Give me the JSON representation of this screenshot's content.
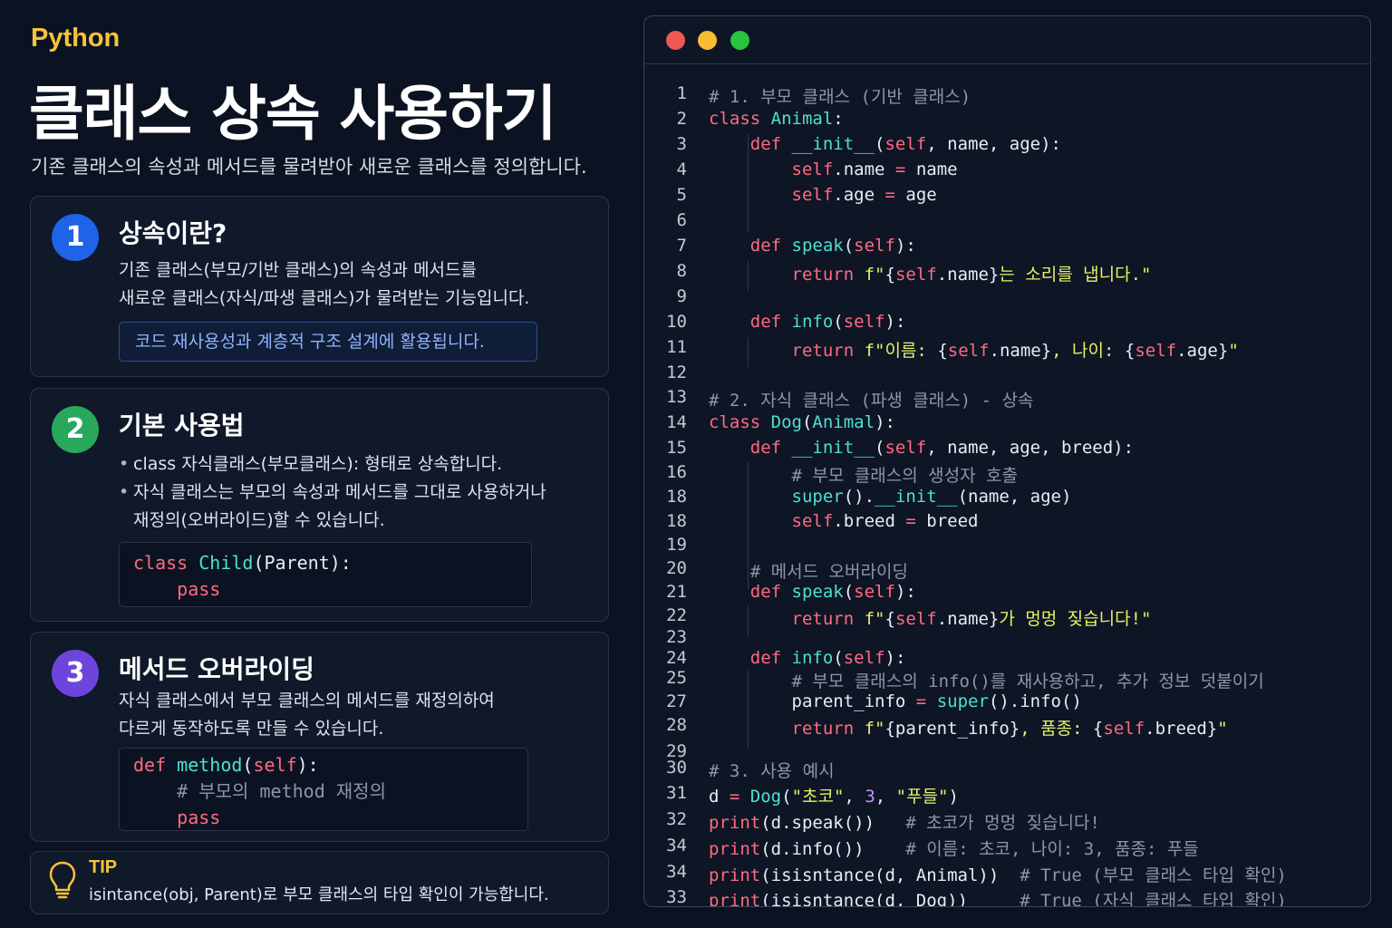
{
  "header": {
    "eyebrow": "Python",
    "title": "클래스 상속 사용하기",
    "subtitle": "기존 클래스의 속성과 메서드를 물려받아 새로운 클래스를 정의합니다."
  },
  "cards": [
    {
      "number": "1",
      "title": "상속이란?",
      "lines": [
        "기존 클래스(부모/기반 클래스)의 속성과 메서드를",
        "새로운 클래스(자식/파생 클래스)가 물려받는 기능입니다."
      ],
      "note": "코드 재사용성과 계층적 구조 설계에 활용됩니다."
    },
    {
      "number": "2",
      "title": "기본 사용법",
      "bullets": [
        {
          "bullet": "•",
          "lines": [
            "class 자식클래스(부모클래스): 형태로 상속합니다."
          ]
        },
        {
          "bullet": "•",
          "lines": [
            "자식 클래스는 부모의 속성과 메서드를 그대로 사용하거나",
            "재정의(오버라이드)할 수 있습니다."
          ]
        }
      ],
      "code": [
        [
          {
            "t": "class ",
            "c": "k"
          },
          {
            "t": "Child",
            "c": "f"
          },
          {
            "t": "(Parent):",
            "c": "t"
          }
        ],
        [
          {
            "t": "    pass",
            "c": "k"
          }
        ]
      ]
    },
    {
      "number": "3",
      "title": "메서드 오버라이딩",
      "lines": [
        "자식 클래스에서 부모 클래스의 메서드를 재정의하여",
        "다르게 동작하도록 만들 수 있습니다."
      ],
      "code": [
        [
          {
            "t": "def ",
            "c": "k"
          },
          {
            "t": "method",
            "c": "f"
          },
          {
            "t": "(",
            "c": "t"
          },
          {
            "t": "self",
            "c": "k"
          },
          {
            "t": "):",
            "c": "t"
          }
        ],
        [
          {
            "t": "    # 부모의 method 재정의",
            "c": "c"
          }
        ],
        [
          {
            "t": "    pass",
            "c": "k"
          }
        ]
      ]
    }
  ],
  "tip": {
    "label": "TIP",
    "text": "isintance(obj, Parent)로 부모 클래스의 타입 확인이 가능합니다."
  },
  "editor": {
    "window_buttons": [
      "close",
      "minimize",
      "maximize"
    ],
    "colors": {
      "close": "#ee5a52",
      "minimize": "#f5bd2f",
      "maximize": "#27c53f"
    },
    "lines": [
      {
        "n": "1",
        "tokens": [
          {
            "t": "# 1. 부모 클래스 (기반 클래스)",
            "c": "c"
          }
        ]
      },
      {
        "n": "2",
        "tokens": [
          {
            "t": "class ",
            "c": "k"
          },
          {
            "t": "Animal",
            "c": "f"
          },
          {
            "t": ":",
            "c": "t"
          }
        ]
      },
      {
        "n": "3",
        "tokens": [
          {
            "t": "    def ",
            "c": "k"
          },
          {
            "t": "__init__",
            "c": "f"
          },
          {
            "t": "(",
            "c": "t"
          },
          {
            "t": "self",
            "c": "k"
          },
          {
            "t": ", name, age):",
            "c": "t"
          }
        ]
      },
      {
        "n": "4",
        "tokens": [
          {
            "t": "        self",
            "c": "k"
          },
          {
            "t": ".name ",
            "c": "t"
          },
          {
            "t": "=",
            "c": "o"
          },
          {
            "t": " name",
            "c": "t"
          }
        ]
      },
      {
        "n": "5",
        "tokens": [
          {
            "t": "        self",
            "c": "k"
          },
          {
            "t": ".age ",
            "c": "t"
          },
          {
            "t": "=",
            "c": "o"
          },
          {
            "t": " age",
            "c": "t"
          }
        ]
      },
      {
        "n": "6",
        "tokens": []
      },
      {
        "n": "7",
        "tokens": [
          {
            "t": "    def ",
            "c": "k"
          },
          {
            "t": "speak",
            "c": "f"
          },
          {
            "t": "(",
            "c": "t"
          },
          {
            "t": "self",
            "c": "k"
          },
          {
            "t": "):",
            "c": "t"
          }
        ]
      },
      {
        "n": "8",
        "tokens": [
          {
            "t": "        return ",
            "c": "k"
          },
          {
            "t": "f\"",
            "c": "s"
          },
          {
            "t": "{",
            "c": "t"
          },
          {
            "t": "self",
            "c": "k"
          },
          {
            "t": ".name}",
            "c": "t"
          },
          {
            "t": "는 소리를 냅니다.\"",
            "c": "s"
          }
        ]
      },
      {
        "n": "9",
        "tokens": []
      },
      {
        "n": "10",
        "tokens": [
          {
            "t": "    def ",
            "c": "k"
          },
          {
            "t": "info",
            "c": "f"
          },
          {
            "t": "(",
            "c": "t"
          },
          {
            "t": "self",
            "c": "k"
          },
          {
            "t": "):",
            "c": "t"
          }
        ]
      },
      {
        "n": "11",
        "tokens": [
          {
            "t": "        return ",
            "c": "k"
          },
          {
            "t": "f\"이름: ",
            "c": "s"
          },
          {
            "t": "{",
            "c": "t"
          },
          {
            "t": "self",
            "c": "k"
          },
          {
            "t": ".name}",
            "c": "t"
          },
          {
            "t": ", 나이: ",
            "c": "s"
          },
          {
            "t": "{",
            "c": "t"
          },
          {
            "t": "self",
            "c": "k"
          },
          {
            "t": ".age}",
            "c": "t"
          },
          {
            "t": "\"",
            "c": "s"
          }
        ]
      },
      {
        "n": "12",
        "tokens": []
      },
      {
        "n": "13",
        "tokens": [
          {
            "t": "# 2. 자식 클래스 (파생 클래스) - 상속",
            "c": "c"
          }
        ]
      },
      {
        "n": "14",
        "tokens": [
          {
            "t": "class ",
            "c": "k"
          },
          {
            "t": "Dog",
            "c": "f"
          },
          {
            "t": "(",
            "c": "t"
          },
          {
            "t": "Animal",
            "c": "f"
          },
          {
            "t": "):",
            "c": "t"
          }
        ]
      },
      {
        "n": "15",
        "tokens": [
          {
            "t": "    def ",
            "c": "k"
          },
          {
            "t": "__init__",
            "c": "f"
          },
          {
            "t": "(",
            "c": "t"
          },
          {
            "t": "self",
            "c": "k"
          },
          {
            "t": ", name, age, breed):",
            "c": "t"
          }
        ]
      },
      {
        "n": "16",
        "tokens": [
          {
            "t": "        # 부모 클래스의 생성자 호출",
            "c": "c"
          }
        ]
      },
      {
        "n": "18",
        "tokens": [
          {
            "t": "        super",
            "c": "f"
          },
          {
            "t": "().",
            "c": "t"
          },
          {
            "t": "__init__",
            "c": "f"
          },
          {
            "t": "(name, age)",
            "c": "t"
          }
        ]
      },
      {
        "n": "18",
        "tokens": [
          {
            "t": "        self",
            "c": "k"
          },
          {
            "t": ".breed ",
            "c": "t"
          },
          {
            "t": "=",
            "c": "o"
          },
          {
            "t": " breed",
            "c": "t"
          }
        ]
      },
      {
        "n": "19",
        "tokens": []
      },
      {
        "n": "20",
        "tokens": [
          {
            "t": "    # 메서드 오버라이딩",
            "c": "c"
          }
        ]
      },
      {
        "n": "21",
        "tokens": [
          {
            "t": "    def ",
            "c": "k"
          },
          {
            "t": "speak",
            "c": "f"
          },
          {
            "t": "(",
            "c": "t"
          },
          {
            "t": "self",
            "c": "k"
          },
          {
            "t": "):",
            "c": "t"
          }
        ]
      },
      {
        "n": "22",
        "tokens": [
          {
            "t": "        return ",
            "c": "k"
          },
          {
            "t": "f\"",
            "c": "s"
          },
          {
            "t": "{",
            "c": "t"
          },
          {
            "t": "self",
            "c": "k"
          },
          {
            "t": ".name}",
            "c": "t"
          },
          {
            "t": "가 멍멍 짖습니다!\"",
            "c": "s"
          }
        ]
      },
      {
        "n": "23",
        "tokens": []
      },
      {
        "n": "24",
        "tokens": [
          {
            "t": "    def ",
            "c": "k"
          },
          {
            "t": "info",
            "c": "f"
          },
          {
            "t": "(",
            "c": "t"
          },
          {
            "t": "self",
            "c": "k"
          },
          {
            "t": "):",
            "c": "t"
          }
        ]
      },
      {
        "n": "25",
        "tokens": [
          {
            "t": "        # 부모 클래스의 info()를 재사용하고, 추가 정보 덧붙이기",
            "c": "c"
          }
        ]
      },
      {
        "n": "27",
        "tokens": [
          {
            "t": "        parent_info ",
            "c": "t"
          },
          {
            "t": "=",
            "c": "o"
          },
          {
            "t": " ",
            "c": "t"
          },
          {
            "t": "super",
            "c": "f"
          },
          {
            "t": "().info()",
            "c": "t"
          }
        ]
      },
      {
        "n": "28",
        "tokens": [
          {
            "t": "        return ",
            "c": "k"
          },
          {
            "t": "f\"",
            "c": "s"
          },
          {
            "t": "{parent_info}",
            "c": "t"
          },
          {
            "t": ", 품종: ",
            "c": "s"
          },
          {
            "t": "{",
            "c": "t"
          },
          {
            "t": "self",
            "c": "k"
          },
          {
            "t": ".breed}",
            "c": "t"
          },
          {
            "t": "\"",
            "c": "s"
          }
        ]
      },
      {
        "n": "29",
        "tokens": []
      },
      {
        "n": "30",
        "tokens": [
          {
            "t": "# 3. 사용 예시",
            "c": "c"
          }
        ]
      },
      {
        "n": "31",
        "tokens": [
          {
            "t": "d ",
            "c": "t"
          },
          {
            "t": "=",
            "c": "o"
          },
          {
            "t": " ",
            "c": "t"
          },
          {
            "t": "Dog",
            "c": "f"
          },
          {
            "t": "(",
            "c": "t"
          },
          {
            "t": "\"초코\"",
            "c": "s"
          },
          {
            "t": ", ",
            "c": "t"
          },
          {
            "t": "3",
            "c": "n"
          },
          {
            "t": ", ",
            "c": "t"
          },
          {
            "t": "\"푸들\"",
            "c": "s"
          },
          {
            "t": ")",
            "c": "t"
          }
        ]
      },
      {
        "n": "32",
        "tokens": [
          {
            "t": "print",
            "c": "k"
          },
          {
            "t": "(d.speak())   ",
            "c": "t"
          },
          {
            "t": "# 초코가 멍멍 짖습니다!",
            "c": "c"
          }
        ]
      },
      {
        "n": "34",
        "tokens": [
          {
            "t": "print",
            "c": "k"
          },
          {
            "t": "(d.info())    ",
            "c": "t"
          },
          {
            "t": "# 이름: 초코, 나이: 3, 품종: 푸들",
            "c": "c"
          }
        ]
      },
      {
        "n": "34",
        "tokens": [
          {
            "t": "print",
            "c": "k"
          },
          {
            "t": "(isisntance(d, Animal))  ",
            "c": "t"
          },
          {
            "t": "# True (부모 클래스 타입 확인)",
            "c": "c"
          }
        ]
      },
      {
        "n": "33",
        "tokens": [
          {
            "t": "print",
            "c": "k"
          },
          {
            "t": "(isisntance(d, Dog))     ",
            "c": "t"
          },
          {
            "t": "# True (자식 클래스 타입 확인)",
            "c": "c"
          }
        ]
      }
    ]
  }
}
